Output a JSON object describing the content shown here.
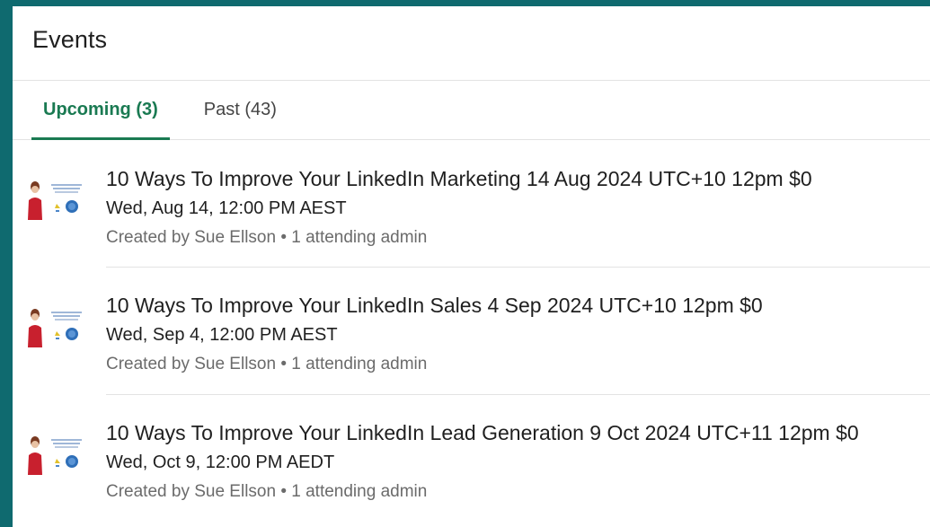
{
  "header": {
    "title": "Events"
  },
  "tabs": [
    {
      "label": "Upcoming (3)",
      "active": true
    },
    {
      "label": "Past (43)",
      "active": false
    }
  ],
  "events": [
    {
      "title": "10 Ways To Improve Your LinkedIn Marketing 14 Aug 2024 UTC+10 12pm $0",
      "date": "Wed, Aug 14, 12:00 PM AEST",
      "meta": "Created by Sue Ellson • 1 attending admin"
    },
    {
      "title": "10 Ways To Improve Your LinkedIn Sales 4 Sep 2024 UTC+10 12pm $0",
      "date": "Wed, Sep 4, 12:00 PM AEST",
      "meta": "Created by Sue Ellson • 1 attending admin"
    },
    {
      "title": "10 Ways To Improve Your LinkedIn Lead Generation 9 Oct 2024 UTC+11 12pm $0",
      "date": "Wed, Oct 9, 12:00 PM AEDT",
      "meta": "Created by Sue Ellson • 1 attending admin"
    }
  ],
  "colors": {
    "frame": "#0f6a6f",
    "accent": "#1a7a52",
    "thumb_person": "#c8202e",
    "thumb_badge": "#2f6fb8",
    "thumb_pin": "#e2c12b"
  },
  "icons": {
    "event_thumbnail": "event-cover-thumbnail"
  }
}
